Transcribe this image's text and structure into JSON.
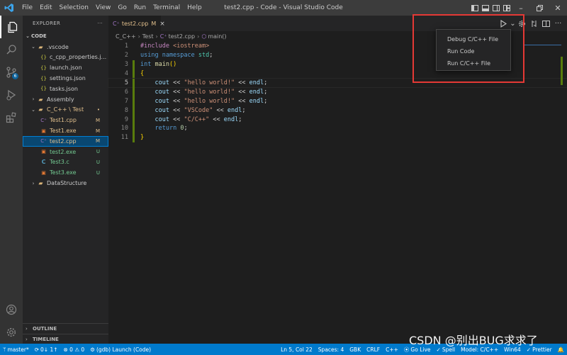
{
  "titlebar": {
    "title": "test2.cpp - Code - Visual Studio Code",
    "menu": [
      "File",
      "Edit",
      "Selection",
      "View",
      "Go",
      "Run",
      "Terminal",
      "Help"
    ]
  },
  "activitybar": {
    "source_control_badge": "6"
  },
  "sidebar": {
    "header": "EXPLORER",
    "more": "···",
    "root": "CODE",
    "items": [
      {
        "label": ".vscode",
        "level": 1,
        "type": "folder-open",
        "status": ""
      },
      {
        "label": "c_cpp_properties.j...",
        "level": 2,
        "type": "json",
        "status": ""
      },
      {
        "label": "launch.json",
        "level": 2,
        "type": "json",
        "status": ""
      },
      {
        "label": "settings.json",
        "level": 2,
        "type": "json",
        "status": ""
      },
      {
        "label": "tasks.json",
        "level": 2,
        "type": "json",
        "status": ""
      },
      {
        "label": "Assembly",
        "level": 1,
        "type": "folder",
        "status": ""
      },
      {
        "label": "C_C++ \\ Test",
        "level": 1,
        "type": "folder-open",
        "status": "•"
      },
      {
        "label": "Test1.cpp",
        "level": 2,
        "type": "cpp",
        "status": "M"
      },
      {
        "label": "Test1.exe",
        "level": 2,
        "type": "exe",
        "status": "M"
      },
      {
        "label": "test2.cpp",
        "level": 2,
        "type": "cpp",
        "status": "M"
      },
      {
        "label": "test2.exe",
        "level": 2,
        "type": "exe",
        "status": "U"
      },
      {
        "label": "Test3.c",
        "level": 2,
        "type": "c",
        "status": "U"
      },
      {
        "label": "Test3.exe",
        "level": 2,
        "type": "exe",
        "status": "U"
      },
      {
        "label": "DataStructure",
        "level": 1,
        "type": "folder",
        "status": ""
      }
    ],
    "outline": "OUTLINE",
    "timeline": "TIMELINE"
  },
  "editor": {
    "tab": {
      "name": "test2.cpp",
      "status": "M",
      "close": "×"
    },
    "breadcrumb": [
      "C_C++",
      "Test",
      "test2.cpp",
      "main()"
    ],
    "line_numbers": [
      "1",
      "2",
      "3",
      "4",
      "5",
      "6",
      "7",
      "8",
      "9",
      "10",
      "11"
    ],
    "code_lines": [
      "#include <iostream>",
      "using namespace std;",
      "int main()",
      "{",
      "    cout << \"hello world!\" << endl;",
      "    cout << \"hello world!\" << endl;",
      "    cout << \"hello world!\" << endl;",
      "    cout << \"VSCode\" << endl;",
      "    cout << \"C/C++\" << endl;",
      "    return 0;",
      "}"
    ]
  },
  "dropdown": {
    "items": [
      "Debug C/C++ File",
      "Run Code",
      "Run C/C++ File"
    ]
  },
  "statusbar": {
    "branch": "master*",
    "sync": "0↓ 1↑",
    "problems": "⊗ 0 ⚠ 0",
    "launch": "(gdb) Launch (Code)",
    "position": "Ln 5, Col 22",
    "spaces": "Spaces: 4",
    "encoding": "GBK",
    "eol": "CRLF",
    "language": "C++",
    "golive": "Go Live",
    "spell": "Spell",
    "model": "Model: C/C++",
    "platform": "Win64",
    "prettier": "Prettier"
  },
  "watermark": "CSDN @别出BUG求求了",
  "colors": {
    "accent": "#007acc",
    "modified": "#e2c08d",
    "untracked": "#73c991",
    "highlight_box": "#e53935"
  }
}
